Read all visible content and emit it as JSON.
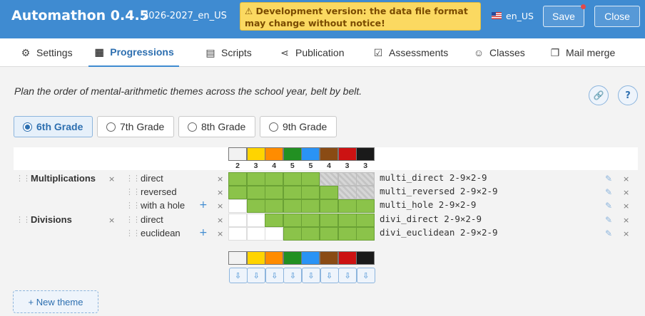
{
  "header": {
    "app_title": "Automathon 0.4.5",
    "subtitle": "2026-2027_en_US",
    "warning": "⚠ Development version: the data file format may change without notice!",
    "lang": "en_US",
    "save_label": "Save",
    "close_label": "Close"
  },
  "tabs": [
    {
      "label": "Settings",
      "icon": "gear-icon",
      "glyph": "⚙"
    },
    {
      "label": "Progressions",
      "icon": "calendar-icon",
      "glyph": "▦",
      "active": true
    },
    {
      "label": "Scripts",
      "icon": "script-icon",
      "glyph": "▤"
    },
    {
      "label": "Publication",
      "icon": "share-icon",
      "glyph": "⋖"
    },
    {
      "label": "Assessments",
      "icon": "checklist-icon",
      "glyph": "☑"
    },
    {
      "label": "Classes",
      "icon": "users-icon",
      "glyph": "☺"
    },
    {
      "label": "Mail merge",
      "icon": "copy-icon",
      "glyph": "❐"
    }
  ],
  "intro": "Plan the order of mental-arithmetic themes across the school year, belt by belt.",
  "grades": [
    {
      "label": "6th Grade",
      "selected": true
    },
    {
      "label": "7th Grade",
      "selected": false
    },
    {
      "label": "8th Grade",
      "selected": false
    },
    {
      "label": "9th Grade",
      "selected": false
    }
  ],
  "belts": {
    "colors": [
      "#f2f2f2",
      "#ffd400",
      "#ff8c00",
      "#229022",
      "#2a93f5",
      "#8a4b14",
      "#cc1212",
      "#1a1a1a"
    ],
    "counts": [
      "2",
      "3",
      "4",
      "5",
      "5",
      "4",
      "3",
      "3"
    ]
  },
  "themes": [
    {
      "name": "Multiplications",
      "subthemes": [
        {
          "label": "direct",
          "plus": false,
          "code": "multi_direct 2-9×2-9",
          "cells": [
            "g",
            "g",
            "g",
            "g",
            "g",
            "h",
            "h",
            "h"
          ]
        },
        {
          "label": "reversed",
          "plus": false,
          "code": "multi_reversed 2-9×2-9",
          "cells": [
            "g",
            "g",
            "g",
            "g",
            "g",
            "g",
            "h",
            "h"
          ]
        },
        {
          "label": "with a hole",
          "plus": true,
          "code": "multi_hole 2-9×2-9",
          "cells": [
            "w",
            "g",
            "g",
            "g",
            "g",
            "g",
            "g",
            "g"
          ]
        }
      ]
    },
    {
      "name": "Divisions",
      "subthemes": [
        {
          "label": "direct",
          "plus": false,
          "code": "divi_direct 2-9×2-9",
          "cells": [
            "w",
            "w",
            "g",
            "g",
            "g",
            "g",
            "g",
            "g"
          ]
        },
        {
          "label": "euclidean",
          "plus": true,
          "code": "divi_euclidean 2-9×2-9",
          "cells": [
            "w",
            "w",
            "w",
            "g",
            "g",
            "g",
            "g",
            "g"
          ]
        }
      ]
    }
  ],
  "plus_glyph": "+",
  "remove_glyph": "×",
  "grip_glyph": "⋮⋮",
  "edit_glyph": "✎",
  "download_glyph": "⇩",
  "link_glyph": "🔗",
  "help_glyph": "?",
  "new_theme_label": "+ New theme"
}
